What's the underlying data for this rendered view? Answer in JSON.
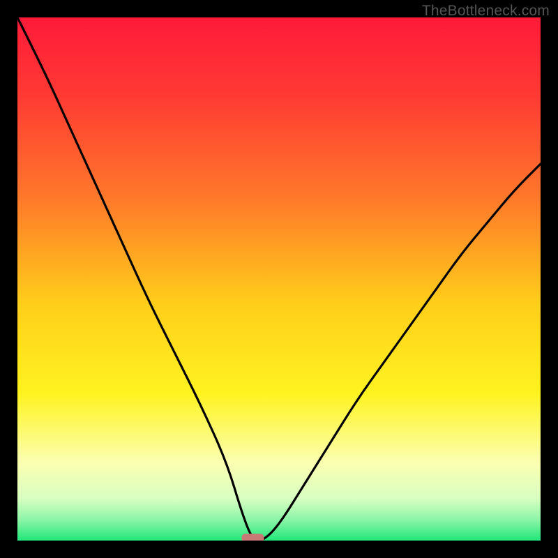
{
  "watermark": "TheBottleneck.com",
  "chart_data": {
    "type": "line",
    "title": "",
    "xlabel": "",
    "ylabel": "",
    "xlim": [
      0,
      100
    ],
    "ylim": [
      0,
      100
    ],
    "optimum_x": 45,
    "series": [
      {
        "name": "bottleneck-curve",
        "x": [
          0,
          5,
          10,
          15,
          20,
          25,
          30,
          35,
          40,
          43,
          45,
          47,
          50,
          55,
          60,
          65,
          70,
          75,
          80,
          85,
          90,
          95,
          100
        ],
        "y": [
          100,
          90,
          79,
          68,
          57,
          46,
          36,
          26,
          15,
          5,
          0,
          0,
          3,
          11,
          19,
          27,
          34,
          41,
          48,
          55,
          61,
          67,
          72
        ]
      }
    ],
    "marker": {
      "x": 45,
      "y": 0.5,
      "color": "#c97a75"
    },
    "gradient_stops": [
      {
        "offset": 0.0,
        "color": "#ff1a3a"
      },
      {
        "offset": 0.15,
        "color": "#ff3a33"
      },
      {
        "offset": 0.35,
        "color": "#ff7a2a"
      },
      {
        "offset": 0.55,
        "color": "#ffcf1a"
      },
      {
        "offset": 0.72,
        "color": "#fff321"
      },
      {
        "offset": 0.85,
        "color": "#fbffb0"
      },
      {
        "offset": 0.92,
        "color": "#d8ffc2"
      },
      {
        "offset": 0.96,
        "color": "#8cf5a8"
      },
      {
        "offset": 1.0,
        "color": "#20e67a"
      }
    ]
  }
}
